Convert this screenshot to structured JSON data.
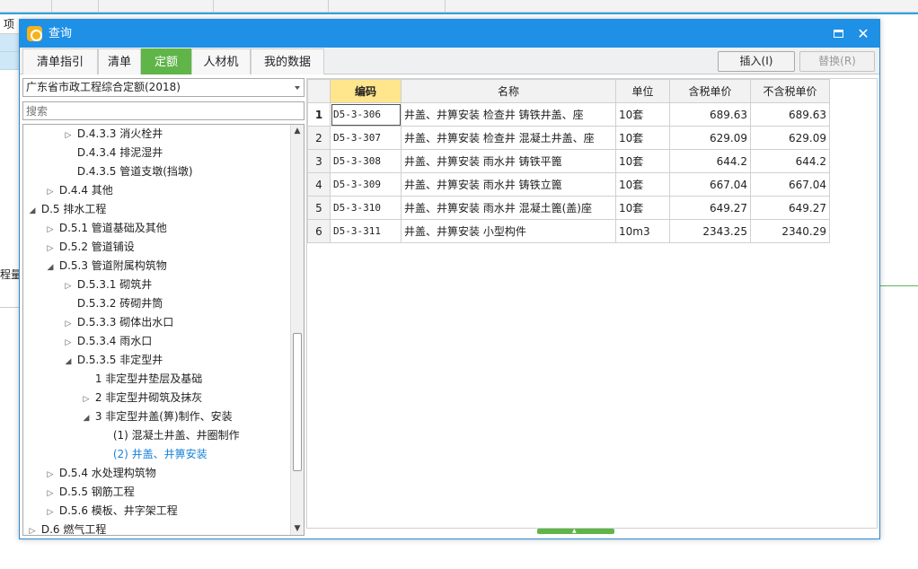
{
  "background": {
    "row_label_1": "项",
    "row_label_2": "程量明"
  },
  "dialog": {
    "title": "查询",
    "minimize_icon": "minimize-icon",
    "close_icon": "close-icon",
    "close_glyph": "✕"
  },
  "tabs": [
    {
      "label": "清单指引",
      "active": false
    },
    {
      "label": "清单",
      "active": false
    },
    {
      "label": "定额",
      "active": true
    },
    {
      "label": "人材机",
      "active": false
    },
    {
      "label": "我的数据",
      "active": false
    }
  ],
  "toolbar": {
    "insert_label": "插入(I)",
    "replace_label": "替换(R)"
  },
  "left": {
    "quota_library": "广东省市政工程综合定额(2018)",
    "search_placeholder": "搜索",
    "tree": [
      {
        "indent": 3,
        "arrow": "▷",
        "label": "D.4.3.3 消火栓井"
      },
      {
        "indent": 3,
        "arrow": "",
        "label": "D.4.3.4 排泥湿井"
      },
      {
        "indent": 3,
        "arrow": "",
        "label": "D.4.3.5 管道支墩(挡墩)"
      },
      {
        "indent": 2,
        "arrow": "▷",
        "label": "D.4.4 其他"
      },
      {
        "indent": 1,
        "arrow": "◢",
        "label": "D.5 排水工程"
      },
      {
        "indent": 2,
        "arrow": "▷",
        "label": "D.5.1 管道基础及其他"
      },
      {
        "indent": 2,
        "arrow": "▷",
        "label": "D.5.2 管道铺设"
      },
      {
        "indent": 2,
        "arrow": "◢",
        "label": "D.5.3 管道附属构筑物"
      },
      {
        "indent": 3,
        "arrow": "▷",
        "label": "D.5.3.1 砌筑井"
      },
      {
        "indent": 3,
        "arrow": "",
        "label": "D.5.3.2 砖砌井筒"
      },
      {
        "indent": 3,
        "arrow": "▷",
        "label": "D.5.3.3 砌体出水口"
      },
      {
        "indent": 3,
        "arrow": "▷",
        "label": "D.5.3.4 雨水口"
      },
      {
        "indent": 3,
        "arrow": "◢",
        "label": "D.5.3.5 非定型井"
      },
      {
        "indent": 4,
        "arrow": "",
        "label": "1 非定型井垫层及基础"
      },
      {
        "indent": 4,
        "arrow": "▷",
        "label": "2 非定型井砌筑及抹灰"
      },
      {
        "indent": 4,
        "arrow": "◢",
        "label": "3 非定型井盖(箅)制作、安装"
      },
      {
        "indent": 5,
        "arrow": "",
        "label": "(1) 混凝土井盖、井圈制作"
      },
      {
        "indent": 5,
        "arrow": "",
        "label": "(2) 井盖、井箅安装",
        "selected": true
      },
      {
        "indent": 2,
        "arrow": "▷",
        "label": "D.5.4 水处理构筑物"
      },
      {
        "indent": 2,
        "arrow": "▷",
        "label": "D.5.5 钢筋工程"
      },
      {
        "indent": 2,
        "arrow": "▷",
        "label": "D.5.6 模板、井字架工程"
      },
      {
        "indent": 1,
        "arrow": "▷",
        "label": "D.6 燃气工程"
      }
    ]
  },
  "grid": {
    "columns": [
      "",
      "编码",
      "名称",
      "单位",
      "含税单价",
      "不含税单价"
    ],
    "rows": [
      {
        "no": "1",
        "code": "D5-3-306",
        "name": "井盖、井箅安装 检查井 铸铁井盖、座",
        "unit": "10套",
        "price_tax": "689.63",
        "price_notax": "689.63"
      },
      {
        "no": "2",
        "code": "D5-3-307",
        "name": "井盖、井箅安装 检查井 混凝土井盖、座",
        "unit": "10套",
        "price_tax": "629.09",
        "price_notax": "629.09"
      },
      {
        "no": "3",
        "code": "D5-3-308",
        "name": "井盖、井箅安装 雨水井 铸铁平篦",
        "unit": "10套",
        "price_tax": "644.2",
        "price_notax": "644.2"
      },
      {
        "no": "4",
        "code": "D5-3-309",
        "name": "井盖、井箅安装 雨水井 铸铁立篦",
        "unit": "10套",
        "price_tax": "667.04",
        "price_notax": "667.04"
      },
      {
        "no": "5",
        "code": "D5-3-310",
        "name": "井盖、井箅安装 雨水井 混凝土篦(盖)座",
        "unit": "10套",
        "price_tax": "649.27",
        "price_notax": "649.27"
      },
      {
        "no": "6",
        "code": "D5-3-311",
        "name": "井盖、井箅安装 小型构件",
        "unit": "10m3",
        "price_tax": "2343.25",
        "price_notax": "2340.29"
      }
    ]
  },
  "colors": {
    "titlebar": "#1e90e6",
    "active_tab": "#5fb548",
    "sorted_header": "#ffe58c",
    "selected_tree": "#1a82d9"
  }
}
